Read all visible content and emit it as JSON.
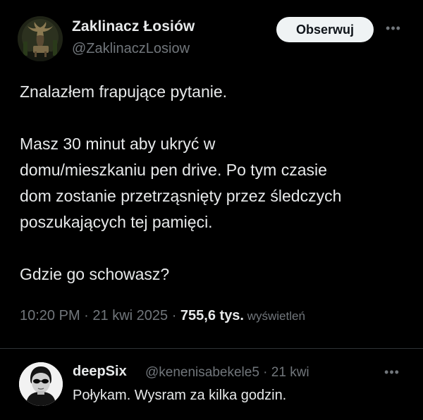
{
  "author": {
    "name": "Zaklinacz Łosiów",
    "handle": "@ZaklinaczLosiow"
  },
  "follow_label": "Obserwuj",
  "more_icon": "more-horizontal-icon",
  "more_glyph": "•••",
  "tweet": {
    "line1": "Znalazłem frapujące pytanie.",
    "line2": "Masz 30 minut aby ukryć w",
    "line3": "domu/mieszkaniu pen drive. Po tym czasie",
    "line4": "dom zostanie przetrząsnięty przez śledczych",
    "line5": "poszukających tej pamięci.",
    "line6": "Gdzie go schowasz?"
  },
  "meta": {
    "time": "10:20 PM",
    "sep1": " · ",
    "date": "21 kwi 2025",
    "sep2": " · ",
    "views": "755,6 tys.",
    "views_label": " wyświetleń"
  },
  "reply": {
    "name": "deepSix",
    "handle": "@kenenisabekele5",
    "sep": " · ",
    "date": "21 kwi",
    "text": "Połykam. Wysram za kilka godzin."
  },
  "colors": {
    "background": "#000000",
    "text": "#e7e9ea",
    "muted": "#71767b",
    "button_bg": "#eff3f4",
    "divider": "#2f3336"
  }
}
